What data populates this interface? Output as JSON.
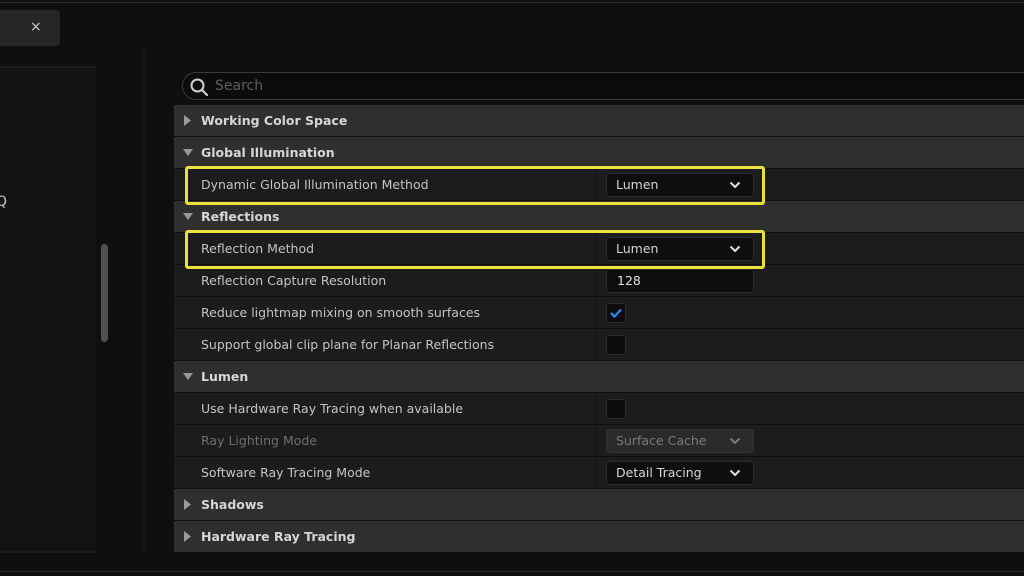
{
  "tab": {
    "close_glyph": "×"
  },
  "left": {
    "glyph": "Q"
  },
  "search": {
    "placeholder": "Search",
    "value": ""
  },
  "colors": {
    "highlight": "#ece13a",
    "check": "#2a8bff"
  },
  "sections": {
    "working_color_space": {
      "label": "Working Color Space",
      "expanded": false
    },
    "global_illumination": {
      "label": "Global Illumination",
      "expanded": true,
      "dgi_method": {
        "label": "Dynamic Global Illumination Method",
        "value": "Lumen"
      }
    },
    "reflections": {
      "label": "Reflections",
      "expanded": true,
      "reflection_method": {
        "label": "Reflection Method",
        "value": "Lumen"
      },
      "capture_resolution": {
        "label": "Reflection Capture Resolution",
        "value": "128"
      },
      "reduce_lightmap": {
        "label": "Reduce lightmap mixing on smooth surfaces",
        "checked": true
      },
      "clip_plane": {
        "label": "Support global clip plane for Planar Reflections",
        "checked": false
      }
    },
    "lumen": {
      "label": "Lumen",
      "expanded": true,
      "hw_ray_tracing": {
        "label": "Use Hardware Ray Tracing when available",
        "checked": false
      },
      "ray_lighting_mode": {
        "label": "Ray Lighting Mode",
        "value": "Surface Cache",
        "disabled": true
      },
      "sw_ray_tracing_mode": {
        "label": "Software Ray Tracing Mode",
        "value": "Detail Tracing"
      }
    },
    "shadows": {
      "label": "Shadows",
      "expanded": false
    },
    "hardware_ray_tracing": {
      "label": "Hardware Ray Tracing",
      "expanded": false
    }
  }
}
